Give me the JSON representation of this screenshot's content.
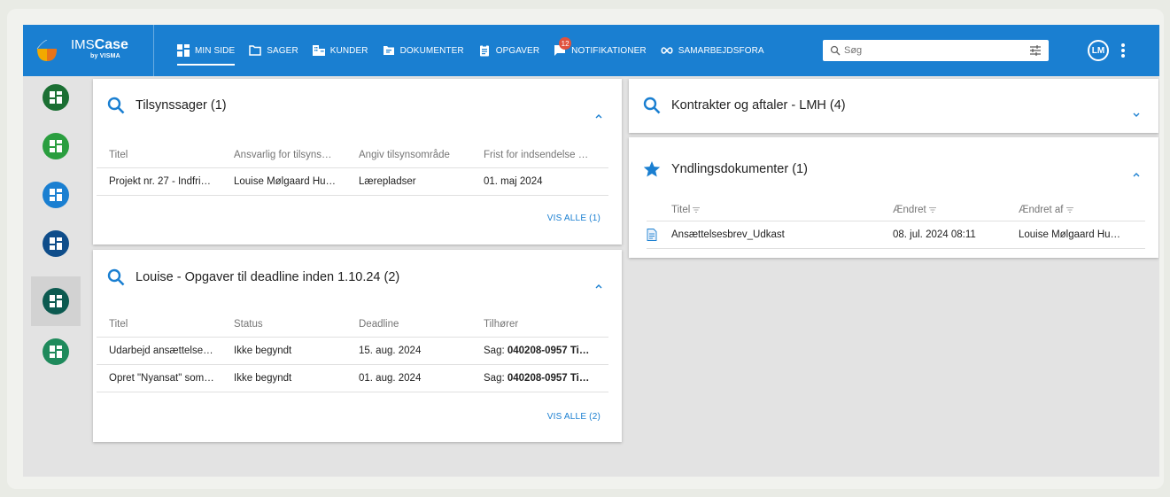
{
  "app": {
    "brand_ims": "IMS",
    "brand_case": "Case",
    "brand_sub": "by VISMA"
  },
  "nav": [
    {
      "label": "MIN SIDE",
      "icon": "dashboard-icon",
      "active": true
    },
    {
      "label": "SAGER",
      "icon": "folder-icon"
    },
    {
      "label": "KUNDER",
      "icon": "building-icon"
    },
    {
      "label": "DOKUMENTER",
      "icon": "document-folder-icon"
    },
    {
      "label": "OPGAVER",
      "icon": "clipboard-icon"
    },
    {
      "label": "NOTIFIKATIONER",
      "icon": "notification-icon",
      "badge": "12"
    },
    {
      "label": "SAMARBEJDSFORA",
      "icon": "infinity-icon"
    }
  ],
  "search": {
    "placeholder": "Søg"
  },
  "user": {
    "initials": "LM"
  },
  "sidebar": {
    "colors": [
      "#1b6f33",
      "#2a9e3f",
      "#1a7fd1",
      "#0f4d8a",
      "#0c5a50",
      "#1f8a5c"
    ],
    "active_index": 4
  },
  "cards": {
    "tilsyn": {
      "title": "Tilsynssager (1)",
      "headers": [
        "Titel",
        "Ansvarlig for tilsyns…",
        "Angiv tilsynsområde",
        "Frist for indsendelse …"
      ],
      "rows": [
        [
          "Projekt nr. 27 - Indfri…",
          "Louise Mølgaard Hu…",
          "Lærepladser",
          "01. maj 2024"
        ]
      ],
      "vis_alle": "VIS ALLE (1)"
    },
    "opgaver": {
      "title": "Louise - Opgaver til deadline inden 1.10.24 (2)",
      "headers": [
        "Titel",
        "Status",
        "Deadline",
        "Tilhører"
      ],
      "rows": [
        {
          "titel": "Udarbejd ansættelse…",
          "status": "Ikke begyndt",
          "deadline": "15. aug. 2024",
          "tilhorer_prefix": "Sag: ",
          "tilhorer_bold": "040208-0957 Ti…"
        },
        {
          "titel": "Opret \"Nyansat\" som…",
          "status": "Ikke begyndt",
          "deadline": "01. aug. 2024",
          "tilhorer_prefix": "Sag: ",
          "tilhorer_bold": "040208-0957 Ti…"
        }
      ],
      "vis_alle": "VIS ALLE (2)"
    },
    "kontrakter": {
      "title": "Kontrakter og aftaler - LMH (4)"
    },
    "yndling": {
      "title": "Yndlingsdokumenter (1)",
      "headers": [
        "Titel",
        "Ændret",
        "Ændret af"
      ],
      "rows": [
        [
          "Ansættelsesbrev_Udkast",
          "08. jul. 2024 08:11",
          "Louise Mølgaard Hu…"
        ]
      ]
    }
  }
}
